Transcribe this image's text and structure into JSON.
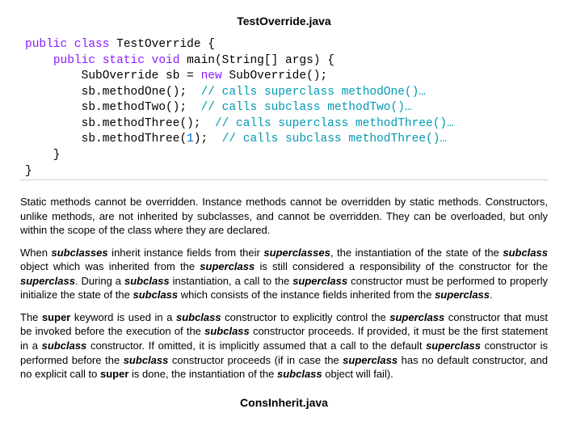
{
  "title": "TestOverride.java",
  "code": {
    "l1a": "public",
    "l1b": " ",
    "l1c": "class",
    "l1d": " TestOverride {",
    "l2pad": "    ",
    "l2a": "public",
    "l2b": " ",
    "l2c": "static",
    "l2d": " ",
    "l2e": "void",
    "l2f": " main(String[] args) {",
    "l3pad": "        ",
    "l3a": "SubOverride sb = ",
    "l3b": "new",
    "l3c": " SubOverride();",
    "l4pad": "        ",
    "l4a": "sb.methodOne();  ",
    "l4b": "// calls superclass methodOne()…",
    "l5pad": "        ",
    "l5a": "sb.methodTwo();  ",
    "l5b": "// calls subclass methodTwo()…",
    "l6pad": "        ",
    "l6a": "sb.methodThree();  ",
    "l6b": "// calls superclass methodThree()…",
    "l7pad": "        ",
    "l7a": "sb.methodThree(",
    "l7b": "1",
    "l7c": ");  ",
    "l7d": "// calls subclass methodThree()…",
    "l8": "    }",
    "l9": "}"
  },
  "para1": {
    "t1": "Static methods cannot be overridden.  Instance methods cannot be overridden by static methods.  Constructors, unlike methods, are not inherited by subclasses, and cannot be overridden.  They can be overloaded, but only within the scope of the class where they are declared."
  },
  "para2": {
    "t1": "When ",
    "b1": "subclasses",
    "t2": " inherit instance fields from their ",
    "b2": "superclasses",
    "t3": ", the instantiation of the state of the ",
    "b3": "subclass",
    "t4": " object which was inherited from the ",
    "b4": "superclass",
    "t5": " is still considered a responsibility of the constructor for the ",
    "b5": "superclass",
    "t6": ".  During a ",
    "b6": "subclass",
    "t7": " instantiation, a call to the ",
    "b7": "superclass",
    "t8": " constructor must be performed to properly initialize the state of the ",
    "b8": "subclass",
    "t9": " which consists of the instance fields inherited from the ",
    "b9": "superclass",
    "t10": "."
  },
  "para3": {
    "t1": "The ",
    "b1": "super",
    "t2": " keyword is used in a ",
    "b2": "subclass",
    "t3": " constructor to explicitly control the ",
    "b3": "superclass",
    "t4": " constructor that must be invoked before the execution of the ",
    "b4": "subclass",
    "t5": " constructor proceeds.  If provided, it must be the first statement in a ",
    "b5": "subclass",
    "t6": " constructor.  If omitted, it is implicitly assumed that a call to the default ",
    "b6": "superclass",
    "t7": " constructor is performed before the ",
    "b7": "subclass",
    "t8": " constructor proceeds (if in case the ",
    "b8": "superclass",
    "t9": " has no default constructor, and no explicit call to ",
    "b9": "super",
    "t10": " is done, the instantiation of the ",
    "b10": "subclass",
    "t11": " object will fail)."
  },
  "footer": "ConsInherit.java"
}
